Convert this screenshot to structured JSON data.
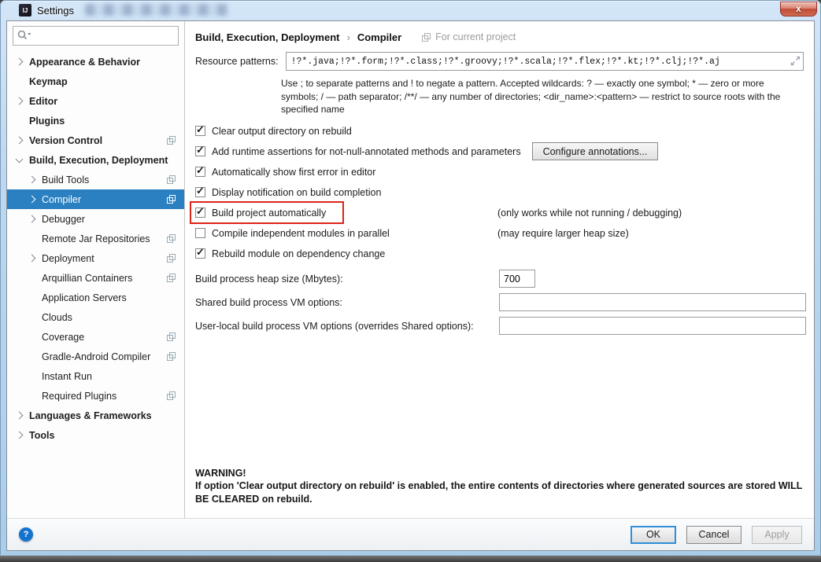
{
  "colors": {
    "selection_blue": "#2a80c1",
    "highlight_red": "#dd2418",
    "titlebar_blue": "#bcd9f0",
    "close_red": "#c14a37"
  },
  "window": {
    "title": "Settings",
    "logo_text": "IJ",
    "close_label": "x"
  },
  "sidebar": {
    "search_placeholder": "",
    "items": [
      {
        "label": "Appearance & Behavior",
        "level": 0,
        "bold": true,
        "chevron": "right",
        "shared": false,
        "selected": false
      },
      {
        "label": "Keymap",
        "level": 0,
        "bold": true,
        "chevron": "none",
        "shared": false,
        "selected": false
      },
      {
        "label": "Editor",
        "level": 0,
        "bold": true,
        "chevron": "right",
        "shared": false,
        "selected": false
      },
      {
        "label": "Plugins",
        "level": 0,
        "bold": true,
        "chevron": "none",
        "shared": false,
        "selected": false
      },
      {
        "label": "Version Control",
        "level": 0,
        "bold": true,
        "chevron": "right",
        "shared": true,
        "selected": false
      },
      {
        "label": "Build, Execution, Deployment",
        "level": 0,
        "bold": true,
        "chevron": "down",
        "shared": false,
        "selected": false
      },
      {
        "label": "Build Tools",
        "level": 1,
        "bold": false,
        "chevron": "right",
        "shared": true,
        "selected": false
      },
      {
        "label": "Compiler",
        "level": 1,
        "bold": false,
        "chevron": "right",
        "shared": true,
        "selected": true
      },
      {
        "label": "Debugger",
        "level": 1,
        "bold": false,
        "chevron": "right",
        "shared": false,
        "selected": false
      },
      {
        "label": "Remote Jar Repositories",
        "level": 1,
        "bold": false,
        "chevron": "none",
        "shared": true,
        "selected": false
      },
      {
        "label": "Deployment",
        "level": 1,
        "bold": false,
        "chevron": "right",
        "shared": true,
        "selected": false
      },
      {
        "label": "Arquillian Containers",
        "level": 1,
        "bold": false,
        "chevron": "none",
        "shared": true,
        "selected": false
      },
      {
        "label": "Application Servers",
        "level": 1,
        "bold": false,
        "chevron": "none",
        "shared": false,
        "selected": false
      },
      {
        "label": "Clouds",
        "level": 1,
        "bold": false,
        "chevron": "none",
        "shared": false,
        "selected": false
      },
      {
        "label": "Coverage",
        "level": 1,
        "bold": false,
        "chevron": "none",
        "shared": true,
        "selected": false
      },
      {
        "label": "Gradle-Android Compiler",
        "level": 1,
        "bold": false,
        "chevron": "none",
        "shared": true,
        "selected": false
      },
      {
        "label": "Instant Run",
        "level": 1,
        "bold": false,
        "chevron": "none",
        "shared": false,
        "selected": false
      },
      {
        "label": "Required Plugins",
        "level": 1,
        "bold": false,
        "chevron": "none",
        "shared": true,
        "selected": false
      },
      {
        "label": "Languages & Frameworks",
        "level": 0,
        "bold": true,
        "chevron": "right",
        "shared": false,
        "selected": false
      },
      {
        "label": "Tools",
        "level": 0,
        "bold": true,
        "chevron": "right",
        "shared": false,
        "selected": false
      }
    ]
  },
  "breadcrumb": {
    "parts": [
      "Build, Execution, Deployment",
      "Compiler"
    ],
    "separator": "›",
    "scope_label": "For current project"
  },
  "resource_patterns": {
    "label": "Resource patterns:",
    "value": "!?*.java;!?*.form;!?*.class;!?*.groovy;!?*.scala;!?*.flex;!?*.kt;!?*.clj;!?*.aj",
    "help": "Use ; to separate patterns and ! to negate a pattern. Accepted wildcards: ? — exactly one symbol; * — zero or more symbols; / — path separator; /**/ — any number of directories; <dir_name>:<pattern> — restrict to source roots with the specified name"
  },
  "checkboxes": [
    {
      "label": "Clear output directory on rebuild",
      "checked": true,
      "highlighted": false,
      "hint": "",
      "button": ""
    },
    {
      "label": "Add runtime assertions for not-null-annotated methods and parameters",
      "checked": true,
      "highlighted": false,
      "hint": "",
      "button": "Configure annotations..."
    },
    {
      "label": "Automatically show first error in editor",
      "checked": true,
      "highlighted": false,
      "hint": "",
      "button": ""
    },
    {
      "label": "Display notification on build completion",
      "checked": true,
      "highlighted": false,
      "hint": "",
      "button": ""
    },
    {
      "label": "Build project automatically",
      "checked": true,
      "highlighted": true,
      "hint": "(only works while not running / debugging)",
      "button": ""
    },
    {
      "label": "Compile independent modules in parallel",
      "checked": false,
      "highlighted": false,
      "hint": "(may require larger heap size)",
      "button": ""
    },
    {
      "label": "Rebuild module on dependency change",
      "checked": true,
      "highlighted": false,
      "hint": "",
      "button": ""
    }
  ],
  "fields": [
    {
      "label": "Build process heap size (Mbytes):",
      "value": "700",
      "size": "small"
    },
    {
      "label": "Shared build process VM options:",
      "value": "",
      "size": "large"
    },
    {
      "label": "User-local build process VM options (overrides Shared options):",
      "value": "",
      "size": "large"
    }
  ],
  "warning": {
    "title": "WARNING!",
    "body": "If option 'Clear output directory on rebuild' is enabled, the entire contents of directories where generated sources are stored WILL BE CLEARED on rebuild."
  },
  "footer": {
    "help_label": "?",
    "ok_label": "OK",
    "cancel_label": "Cancel",
    "apply_label": "Apply"
  }
}
